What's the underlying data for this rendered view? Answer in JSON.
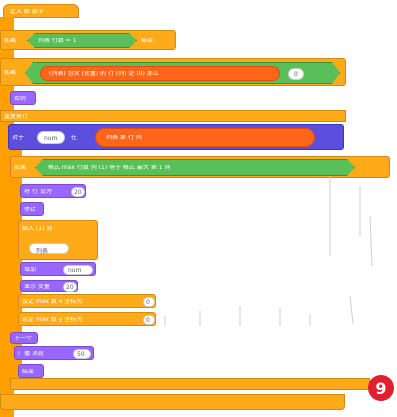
{
  "blocks": {
    "define_label": "定义 解 数字",
    "if1": {
      "cond": "列表 行数 = 1",
      "result": "结束"
    },
    "if2": {
      "cond": "(列表) 包含 (变量) 的 行 (列) 是 (0) 那么"
    },
    "else_label": "否则",
    "repeat_label": "重复执行",
    "for_each": {
      "label": "对于",
      "var": "num",
      "in": "在",
      "expr": "列表 第 行 列"
    },
    "if3": {
      "cond": "格式 max 行数 列 (1) 等于 格式 最大 第 1 列"
    },
    "set1": {
      "label": "将 行 设为",
      "value": "20"
    },
    "stop_label": "停止",
    "insert1": {
      "label": "插入 (1) 到",
      "value": "列表"
    },
    "change": {
      "label": "增加",
      "value": "num"
    },
    "show1": {
      "label": "显示 变量",
      "value": "20"
    },
    "set_x": {
      "label": "设定 max 数 x 坐标为",
      "value": "0"
    },
    "set_y": {
      "label": "设定 max 数 y 坐标为",
      "value": "0"
    },
    "next_label": "下一个",
    "broadcast": {
      "label": "广播 消息",
      "value": "50"
    },
    "end_label": "结束"
  },
  "badge": "9",
  "colors": {
    "orange": "#ffab19",
    "purple": "#9966ff",
    "green": "#59c059",
    "red": "#ff661a",
    "badge": "#e0202f"
  }
}
